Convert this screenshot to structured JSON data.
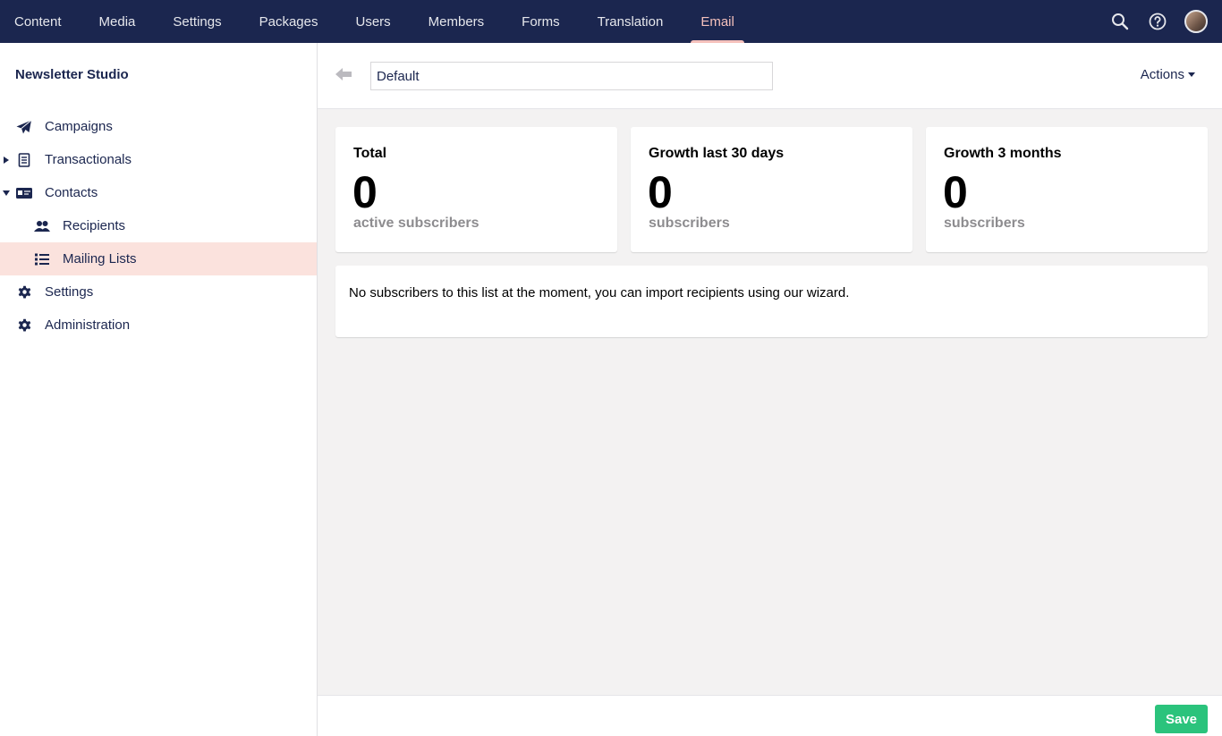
{
  "topnav": {
    "items": [
      {
        "label": "Content"
      },
      {
        "label": "Media"
      },
      {
        "label": "Settings"
      },
      {
        "label": "Packages"
      },
      {
        "label": "Users"
      },
      {
        "label": "Members"
      },
      {
        "label": "Forms"
      },
      {
        "label": "Translation"
      },
      {
        "label": "Email",
        "active": true
      }
    ],
    "icons": [
      "search-icon",
      "help-icon",
      "user-avatar"
    ]
  },
  "sidebar": {
    "title": "Newsletter Studio",
    "items": [
      {
        "label": "Campaigns",
        "icon": "paper-plane-icon"
      },
      {
        "label": "Transactionals",
        "icon": "receipt-icon",
        "caret": "right"
      },
      {
        "label": "Contacts",
        "icon": "id-card-icon",
        "caret": "down"
      },
      {
        "label": "Recipients",
        "icon": "users-icon"
      },
      {
        "label": "Mailing Lists",
        "icon": "list-icon",
        "selected": true
      },
      {
        "label": "Settings",
        "icon": "gear-icon"
      },
      {
        "label": "Administration",
        "icon": "gear-icon"
      }
    ]
  },
  "header": {
    "name_value": "Default",
    "actions_label": "Actions"
  },
  "stats": [
    {
      "title": "Total",
      "value": "0",
      "subtitle": "active subscribers"
    },
    {
      "title": "Growth last 30 days",
      "value": "0",
      "subtitle": "subscribers"
    },
    {
      "title": "Growth 3 months",
      "value": "0",
      "subtitle": "subscribers"
    }
  ],
  "empty_message": "No subscribers to this list at the moment, you can import recipients using our wizard.",
  "footer": {
    "save_label": "Save"
  },
  "colors": {
    "topbar": "#1b264f",
    "active_nav": "#f5c1bc",
    "selected_item": "#fbe2dd",
    "save": "#2bc37c"
  }
}
